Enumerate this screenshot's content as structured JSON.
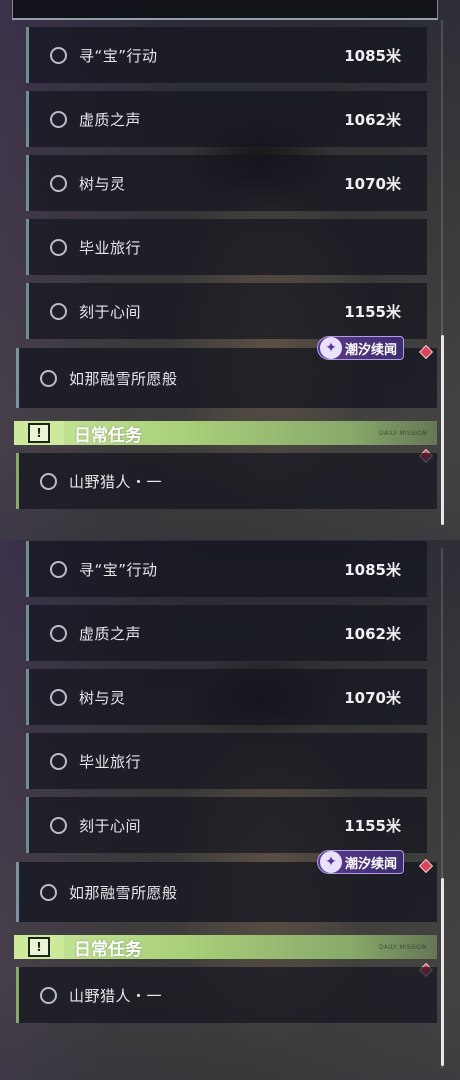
{
  "quests": [
    {
      "name": "寻“宝”行动",
      "distance": "1085米"
    },
    {
      "name": "虚质之声",
      "distance": "1062米"
    },
    {
      "name": "树与灵",
      "distance": "1070米"
    },
    {
      "name": "毕业旅行",
      "distance": ""
    },
    {
      "name": "刻于心间",
      "distance": "1155米"
    }
  ],
  "featured": {
    "name": "如那融雪所愿般",
    "badge": "潮汐续闻"
  },
  "daily": {
    "header": "日常任务",
    "header_small": "DAILY MISSION",
    "item": "山野猎人・一"
  },
  "colors": {
    "accent_green": "#a9d07a",
    "badge_purple": "#5b3a8a",
    "marker_red": "#d8455a"
  },
  "icons": {
    "quest_status": "circle-icon",
    "badge": "sparkle-icon",
    "daily": "exclamation-icon",
    "marker": "diamond-marker-icon"
  }
}
